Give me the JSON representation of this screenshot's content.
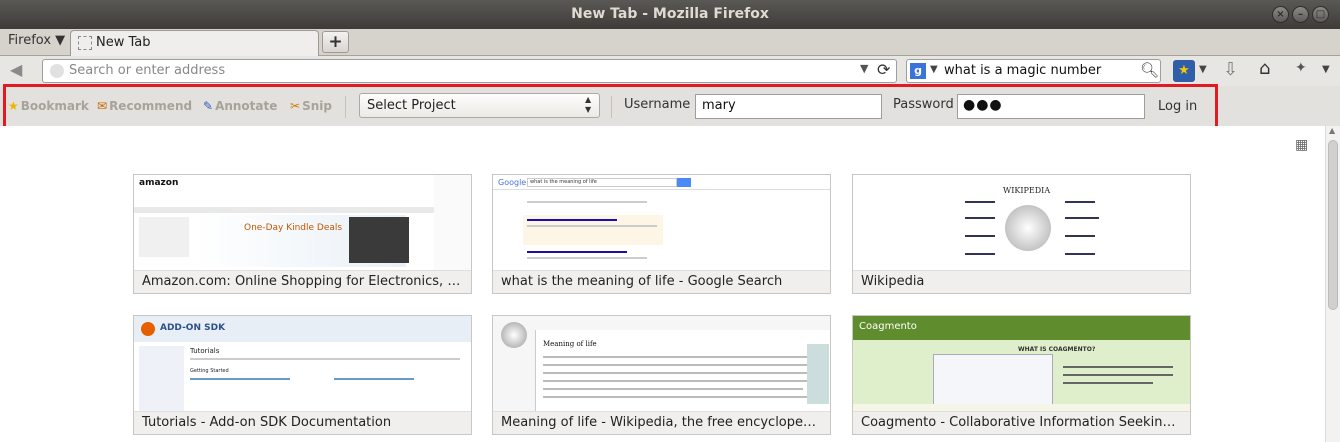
{
  "window": {
    "title": "New Tab - Mozilla Firefox"
  },
  "tabbar": {
    "menu_label": "Firefox ▼",
    "tab_label": "New Tab",
    "newtab_label": "+"
  },
  "navbar": {
    "url_placeholder": "Search or enter address",
    "search_value": "what is a magic number",
    "search_engine_glyph": "g"
  },
  "coagmento_toolbar": {
    "bookmark": "Bookmark",
    "recommend": "Recommend",
    "annotate": "Annotate",
    "snip": "Snip",
    "project_select": "Select Project",
    "username_label": "Username",
    "username_value": "mary",
    "password_label": "Password",
    "password_mask": "●●●",
    "login": "Log in"
  },
  "thumbnails": [
    {
      "title": "Amazon.com: Online Shopping for Electronics, App...",
      "preview": {
        "logo": "amazon",
        "promo": "One-Day Kindle Deals"
      }
    },
    {
      "title": "what is the meaning of life - Google Search",
      "preview": {
        "logo": "Google",
        "query": "what is the meaning of life"
      }
    },
    {
      "title": "Wikipedia",
      "preview": {
        "logo": "WIKIPEDIA"
      }
    },
    {
      "title": "Tutorials - Add-on SDK Documentation",
      "preview": {
        "logo": "ADD-ON SDK",
        "heading": "Tutorials",
        "sub": "Getting Started"
      }
    },
    {
      "title": "Meaning of life - Wikipedia, the free encyclopedia",
      "preview": {
        "heading": "Meaning of life"
      }
    },
    {
      "title": "Coagmento - Collaborative Information Seeking/Ret...",
      "preview": {
        "logo": "Coagmento",
        "heading": "WHAT IS COAGMENTO?"
      }
    }
  ],
  "colors": {
    "highlight_border": "#e21b23",
    "titlebar": "#3d3c38"
  },
  "icons": [
    "close-icon",
    "minimize-icon",
    "maximize-icon",
    "back-icon",
    "globe-icon",
    "reload-icon",
    "search-icon",
    "bookmarks-icon",
    "download-icon",
    "home-icon",
    "addon-icon",
    "grid-icon",
    "star-icon"
  ]
}
